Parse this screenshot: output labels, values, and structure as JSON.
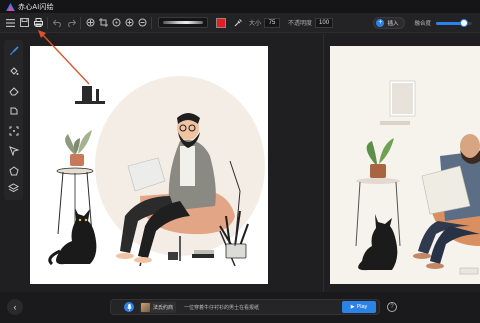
{
  "app": {
    "title": "赤心AI闪绘"
  },
  "toolbar": {
    "size_label": "大小",
    "size_value": "75",
    "opacity_label": "不透明度",
    "opacity_value": "100",
    "brush_color": "#e02020",
    "insert_label": "插入",
    "blend_label": "融合度",
    "blend_level_percent": 78
  },
  "sidebar": {
    "tools": [
      "brush-icon",
      "fill-icon",
      "eraser-icon",
      "lasso-icon",
      "crop-icon",
      "select-arrow-icon",
      "polygon-icon"
    ],
    "layers_icon": "layers-icon"
  },
  "bottombar": {
    "style_label": "法氏约商",
    "prompt_text": "一位穿着牛仔衬衫的男士在看报纸",
    "play_label": "Play",
    "help_icon": "help-icon"
  },
  "colors": {
    "accent": "#2b83e8",
    "annotation_arrow": "#d9542b"
  }
}
